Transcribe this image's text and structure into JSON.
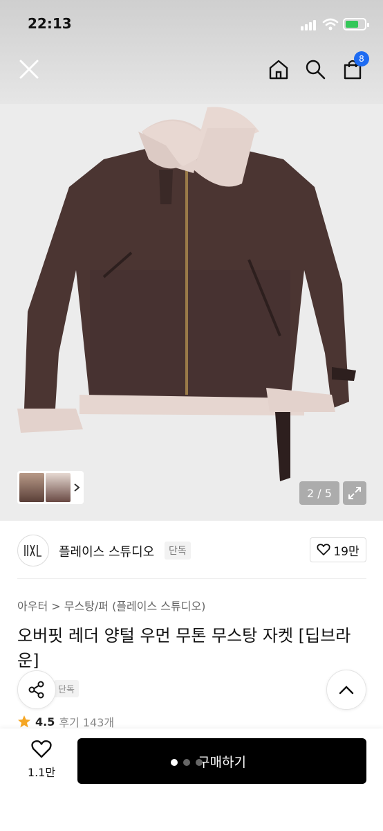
{
  "status_bar": {
    "time": "22:13"
  },
  "header": {
    "cart_count": "8"
  },
  "gallery": {
    "page_indicator": "2 / 5"
  },
  "brand": {
    "name": "플레이스 스튜디오",
    "tag": "단독",
    "likes": "19만"
  },
  "breadcrumb": {
    "text": "아우터 > 무스탕/퍼 (플레이스 스튜디오)"
  },
  "product": {
    "title": "오버핏 레더 양털 우먼 무톤 무스탕 자켓 [딥브라운]",
    "exclusive_tag": "단독",
    "rating": "4.5",
    "reviews": "후기 143개"
  },
  "bottom_bar": {
    "wish_count": "1.1만",
    "buy_label": "구매하기"
  },
  "colors": {
    "accent": "#1d6bf2",
    "buy_bg": "#000000",
    "star": "#f5a623"
  }
}
